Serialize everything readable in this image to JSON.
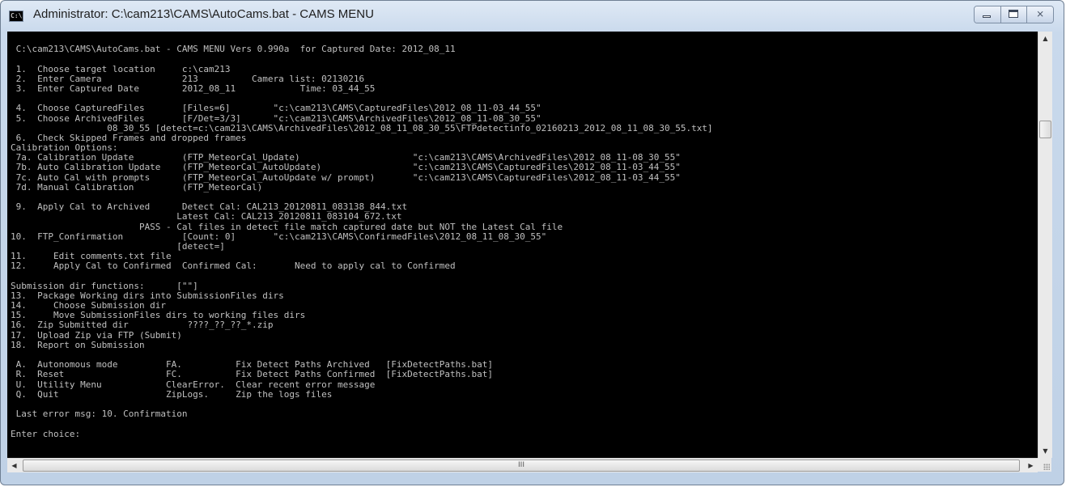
{
  "window": {
    "title": "Administrator:  C:\\cam213\\CAMS\\AutoCams.bat - CAMS MENU",
    "app_icon_text": "C:\\",
    "close_glyph": "⨯"
  },
  "scrollbar": {
    "up_glyph": "▲",
    "down_glyph": "▼",
    "left_glyph": "◀",
    "right_glyph": "▶",
    "h_thumb_grip": "III"
  },
  "console": {
    "lines": [
      "",
      " C:\\cam213\\CAMS\\AutoCams.bat - CAMS MENU Vers 0.990a  for Captured Date: 2012_08_11",
      "",
      " 1.  Choose target location     c:\\cam213",
      " 2.  Enter Camera               213          Camera list: 02130216",
      " 3.  Enter Captured Date        2012_08_11            Time: 03_44_55",
      "",
      " 4.  Choose CapturedFiles       [Files=6]        \"c:\\cam213\\CAMS\\CapturedFiles\\2012_08_11-03_44_55\"",
      " 5.  Choose ArchivedFiles       [F/Det=3/3]      \"c:\\cam213\\CAMS\\ArchivedFiles\\2012_08_11-08_30_55\"",
      "                  08_30_55 [detect=c:\\cam213\\CAMS\\ArchivedFiles\\2012_08_11_08_30_55\\FTPdetectinfo_02160213_2012_08_11_08_30_55.txt]",
      " 6.  Check Skipped Frames and dropped frames",
      "Calibration Options:",
      " 7a. Calibration Update         (FTP_MeteorCal_Update)                     \"c:\\cam213\\CAMS\\ArchivedFiles\\2012_08_11-08_30_55\"",
      " 7b. Auto Calibration Update    (FTP_MeteorCal_AutoUpdate)                 \"c:\\cam213\\CAMS\\CapturedFiles\\2012_08_11-03_44_55\"",
      " 7c. Auto Cal with prompts      (FTP_MeteorCal_AutoUpdate w/ prompt)       \"c:\\cam213\\CAMS\\CapturedFiles\\2012_08_11-03_44_55\"",
      " 7d. Manual Calibration         (FTP_MeteorCal)",
      "",
      " 9.  Apply Cal to Archived      Detect Cal: CAL213_20120811_083138_844.txt",
      "                               Latest Cal: CAL213_20120811_083104_672.txt",
      "                        PASS - Cal files in detect file match captured date but NOT the Latest Cal file",
      "10.  FTP_Confirmation           [Count: 0]       \"c:\\cam213\\CAMS\\ConfirmedFiles\\2012_08_11_08_30_55\"",
      "                               [detect=]",
      "11.     Edit comments.txt file",
      "12.     Apply Cal to Confirmed  Confirmed Cal:       Need to apply cal to Confirmed",
      "",
      "Submission dir functions:      [\"\"]",
      "13.  Package Working dirs into SubmissionFiles dirs",
      "14.     Choose Submission dir",
      "15.     Move SubmissionFiles dirs to working files dirs",
      "16.  Zip Submitted dir           ????_??_??_*.zip",
      "17.  Upload Zip via FTP (Submit)",
      "18.  Report on Submission",
      "",
      " A.  Autonomous mode         FA.          Fix Detect Paths Archived   [FixDetectPaths.bat]",
      " R.  Reset                   FC.          Fix Detect Paths Confirmed  [FixDetectPaths.bat]",
      " U.  Utility Menu            ClearError.  Clear recent error message",
      " Q.  Quit                    ZipLogs.     Zip the logs files",
      "",
      " Last error msg: 10. Confirmation",
      "",
      "Enter choice:"
    ]
  }
}
